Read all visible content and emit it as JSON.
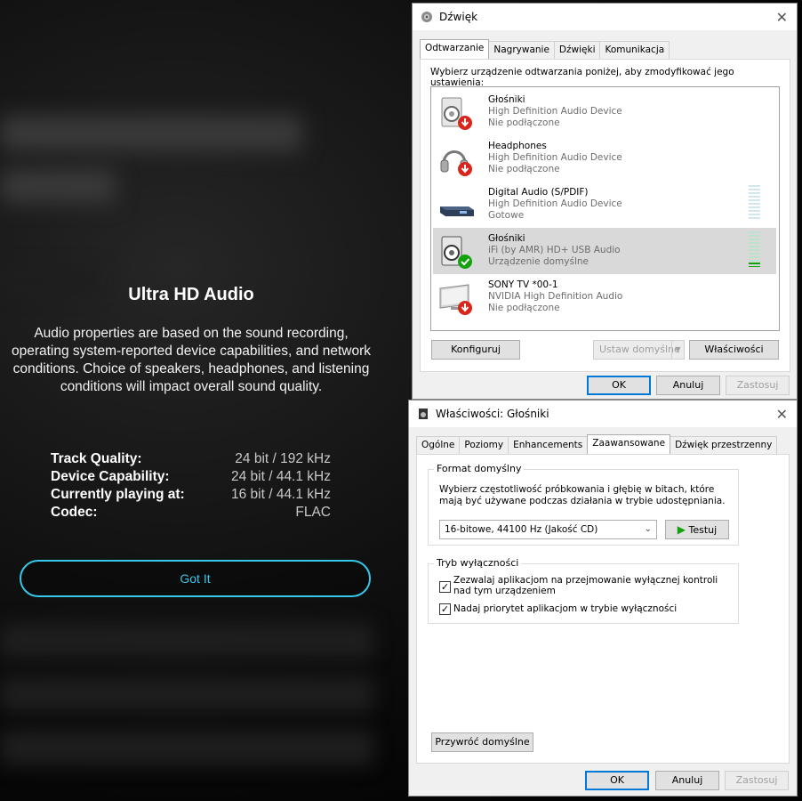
{
  "ultra_hd": {
    "title": "Ultra HD Audio",
    "description": "Audio properties are based on the sound recording, operating system-reported device capabilities, and network conditions. Choice of speakers, headphones, and listening conditions will impact overall sound quality.",
    "stats": [
      {
        "label": "Track Quality:",
        "value": "24 bit / 192 kHz"
      },
      {
        "label": "Device Capability:",
        "value": "24 bit / 44.1 kHz"
      },
      {
        "label": "Currently playing at:",
        "value": "16 bit / 44.1 kHz"
      },
      {
        "label": "Codec:",
        "value": "FLAC"
      }
    ],
    "button": "Got It",
    "accent_color": "#37c8e8"
  },
  "sound_dialog": {
    "title": "Dźwięk",
    "tabs": [
      "Odtwarzanie",
      "Nagrywanie",
      "Dźwięki",
      "Komunikacja"
    ],
    "instruction": "Wybierz urządzenie odtwarzania poniżej, aby zmodyfikować jego ustawienia:",
    "devices": [
      {
        "name": "Głośniki",
        "driver": "High Definition Audio Device",
        "status": "Nie podłączone",
        "icon": "speaker-icon"
      },
      {
        "name": "Headphones",
        "driver": "High Definition Audio Device",
        "status": "Nie podłączone",
        "icon": "headphones-icon"
      },
      {
        "name": "Digital Audio (S/PDIF)",
        "driver": "High Definition Audio Device",
        "status": "Gotowe",
        "icon": "digital-audio-icon"
      },
      {
        "name": "Głośniki",
        "driver": "iFi (by AMR) HD+ USB Audio",
        "status": "Urządzenie domyślne",
        "icon": "speaker-icon",
        "selected": true
      },
      {
        "name": "SONY TV  *00-1",
        "driver": "NVIDIA High Definition Audio",
        "status": "Nie podłączone",
        "icon": "monitor-icon"
      }
    ],
    "buttons": {
      "configure": "Konfiguruj",
      "set_default": "Ustaw domyślne",
      "properties": "Właściwości",
      "ok": "OK",
      "cancel": "Anuluj",
      "apply": "Zastosuj"
    }
  },
  "props_dialog": {
    "title": "Właściwości: Głośniki",
    "tabs": [
      "Ogólne",
      "Poziomy",
      "Enhancements",
      "Zaawansowane",
      "Dźwięk przestrzenny"
    ],
    "format_group": "Format domyślny",
    "format_desc": "Wybierz częstotliwość próbkowania i głębię w bitach, które mają być używane podczas działania w trybie udostępniania.",
    "format_value": "16-bitowe, 44100 Hz (Jakość CD)",
    "test_button": "Testuj",
    "exclusive_group": "Tryb wyłączności",
    "exclusive_opt1": "Zezwalaj aplikacjom na przejmowanie wyłącznej kontroli nad tym urządzeniem",
    "exclusive_opt2": "Nadaj priorytet aplikacjom w trybie wyłączności",
    "restore_button": "Przywróć domyślne",
    "buttons": {
      "ok": "OK",
      "cancel": "Anuluj",
      "apply": "Zastosuj"
    }
  }
}
